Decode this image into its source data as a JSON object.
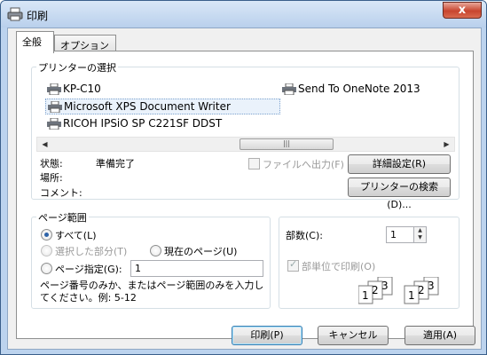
{
  "window": {
    "title": "印刷",
    "close_label": "x"
  },
  "tabs": [
    {
      "label": "全般"
    },
    {
      "label": "オプション"
    }
  ],
  "printer_group": {
    "label": "プリンターの選択",
    "printers": [
      {
        "name": "KP-C10",
        "icon": "printer-icon"
      },
      {
        "name": "Send To OneNote 2013",
        "icon": "printer-icon"
      },
      {
        "name": "Microsoft XPS Document Writer",
        "icon": "printer-icon",
        "selected": true
      },
      {
        "name": "RICOH IPSiO SP C221SF DDST",
        "icon": "printer-icon"
      }
    ],
    "scroll_left": "◀",
    "scroll_right": "▶",
    "scroll_thumb": "|||"
  },
  "status": {
    "state_label": "状態:",
    "state_value": "準備完了",
    "location_label": "場所:",
    "comment_label": "コメント:",
    "print_to_file_label": "ファイルへ出力(F)",
    "preferences_button": "詳細設定(R)",
    "find_printer_button": "プリンターの検索(D)..."
  },
  "page_range": {
    "label": "ページ範囲",
    "all": "すべて(L)",
    "selection": "選択した部分(T)",
    "current_page": "現在のページ(U)",
    "pages": "ページ指定(G):",
    "pages_value": "1",
    "hint_line1": "ページ番号のみか、またはページ範囲のみを入力し",
    "hint_line2": "てください。例: 5-12"
  },
  "copies": {
    "label": "部数(C):",
    "value": "1",
    "collate": "部単位で印刷(O)",
    "collate_pages": [
      "1",
      "2",
      "3"
    ]
  },
  "buttons": {
    "print": "印刷(P)",
    "cancel": "キャンセル",
    "apply": "適用(A)"
  }
}
